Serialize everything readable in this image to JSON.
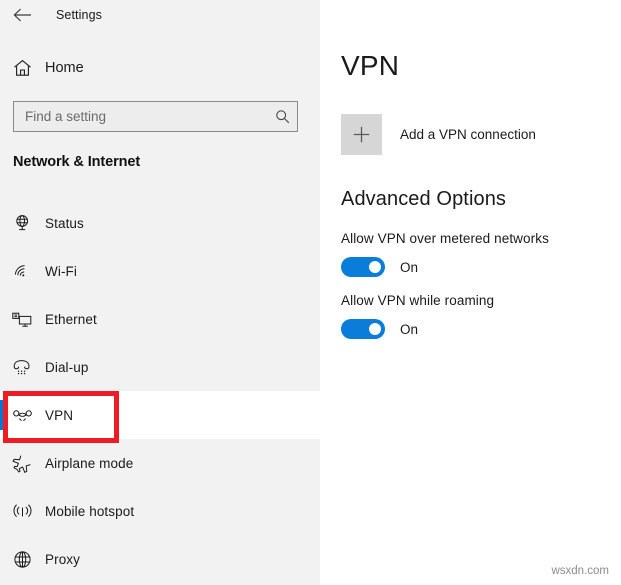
{
  "window": {
    "title": "Settings",
    "back_icon": "back-arrow-icon"
  },
  "sidebar": {
    "home": {
      "label": "Home",
      "icon": "home-icon"
    },
    "search": {
      "value": "",
      "placeholder": "Find a setting",
      "icon": "search-icon"
    },
    "section_title": "Network & Internet",
    "items": [
      {
        "label": "Status",
        "icon": "status-globe-icon",
        "selected": false
      },
      {
        "label": "Wi-Fi",
        "icon": "wifi-icon",
        "selected": false
      },
      {
        "label": "Ethernet",
        "icon": "ethernet-icon",
        "selected": false
      },
      {
        "label": "Dial-up",
        "icon": "dialup-phone-icon",
        "selected": false
      },
      {
        "label": "VPN",
        "icon": "vpn-key-icon",
        "selected": true
      },
      {
        "label": "Airplane mode",
        "icon": "airplane-icon",
        "selected": false
      },
      {
        "label": "Mobile hotspot",
        "icon": "hotspot-icon",
        "selected": false
      },
      {
        "label": "Proxy",
        "icon": "proxy-globe-icon",
        "selected": false
      }
    ]
  },
  "main": {
    "page_title": "VPN",
    "add_connection": {
      "label": "Add a VPN connection",
      "icon": "plus-icon"
    },
    "advanced_title": "Advanced Options",
    "settings": [
      {
        "label": "Allow VPN over metered networks",
        "state": "On",
        "on": true
      },
      {
        "label": "Allow VPN while roaming",
        "state": "On",
        "on": true
      }
    ]
  },
  "annotation": {
    "target": "VPN",
    "color": "#ee1c25"
  },
  "watermark": "wsxdn.com",
  "colors": {
    "accent": "#0078d7",
    "toggle_on": "#0a7ddb",
    "sidebar_bg": "#f2f2f2",
    "content_bg": "#ffffff",
    "annotation_red": "#ee1c25"
  }
}
